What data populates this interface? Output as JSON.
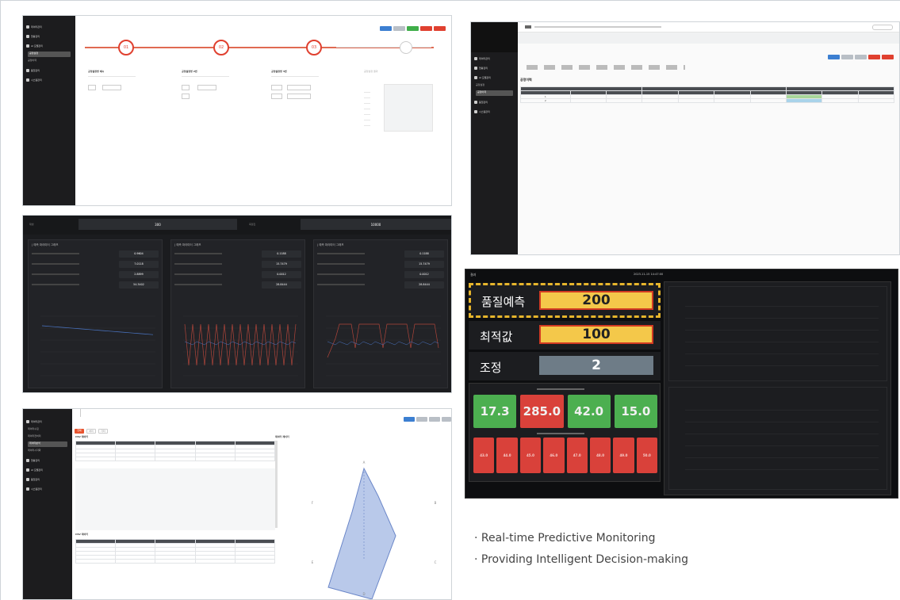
{
  "panel1": {
    "steps": [
      "01",
      "02",
      "03"
    ],
    "labels": [
      "공정설정명 예시",
      "공정설정명 2번",
      "공정설정명 3번",
      "공정설정 결과"
    ],
    "inputs": [
      "-",
      "▼",
      "▼",
      "▼"
    ],
    "button_colors": [
      "#3c7fd1",
      "#b9bfc6",
      "#3fae49",
      "#e0402f",
      "#e0402f"
    ]
  },
  "panel2": {
    "title": "공정이력",
    "subtitle": "2 건의 데이터",
    "header_cols": [
      "",
      "",
      "",
      "",
      "",
      "",
      "",
      "",
      "",
      ""
    ],
    "rows": [
      [
        "1",
        "",
        "",
        "",
        "",
        "",
        "",
        "",
        "",
        ""
      ],
      [
        "2",
        "",
        "",
        "",
        "",
        "",
        "",
        "",
        "",
        ""
      ]
    ]
  },
  "panel3": {
    "top_left_label": "재생",
    "top_left_value": "300",
    "top_right_label": "측정값",
    "top_right_value": "10000",
    "cards": [
      {
        "title": "| 예측 파라미터 그래프",
        "rows": [
          [
            "",
            ""
          ],
          [
            "",
            ""
          ],
          [
            "",
            ""
          ],
          [
            "",
            ""
          ]
        ],
        "values": [
          "0.9604",
          "7.0118",
          "2.8899",
          "54.3402"
        ]
      },
      {
        "title": "| 예측 파라미터 그래프",
        "rows": [
          [
            "",
            ""
          ],
          [
            "",
            ""
          ],
          [
            "",
            ""
          ],
          [
            "",
            ""
          ]
        ],
        "values": [
          "0.1188",
          "15.7479",
          "0.0012",
          "28.8444"
        ]
      },
      {
        "title": "| 예측 파라미터 그래프",
        "rows": [
          [
            "",
            ""
          ],
          [
            "",
            ""
          ],
          [
            "",
            ""
          ],
          [
            "",
            ""
          ]
        ],
        "values": [
          "0.1188",
          "15.7479",
          "0.0012",
          "28.8444"
        ]
      }
    ]
  },
  "panel4": {
    "corner": "결과",
    "timestamp": "2023-11-15 14:47:00",
    "quality_label": "품질예측",
    "quality_value": "200",
    "optimal_label": "최적값",
    "optimal_value": "100",
    "adjust_label": "조정",
    "adjust_value": "2",
    "green_tiles": [
      "17.3",
      "285.0",
      "42.0",
      "15.0"
    ],
    "red_tiles": [
      "43.0",
      "44.0",
      "45.0",
      "46.0",
      "47.0",
      "48.0",
      "49.0",
      "50.0"
    ]
  },
  "panel5": {
    "tabs": [
      "전체",
      "처리",
      "기타"
    ],
    "table1_title": "CSV 데이터",
    "table2_title": "CSV 데이터",
    "chart_title": "데이터 레이더",
    "radar_labels": [
      "A",
      "B",
      "C",
      "D",
      "E",
      "F"
    ]
  },
  "bullets": [
    "· Real-time Predictive Monitoring",
    "· Providing Intelligent Decision-making"
  ],
  "colors": {
    "accent_red": "#e0402f",
    "yellow": "#f4c84a",
    "blue": "#3c7fd1",
    "green": "#4caf50"
  }
}
